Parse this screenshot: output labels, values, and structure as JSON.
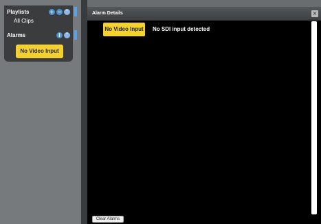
{
  "sidebar": {
    "playlists": {
      "label": "Playlists",
      "add_icon": "plus-circle-icon",
      "remove_icon": "minus-circle-icon",
      "collapse_icon": "chevron-up-circle-icon",
      "items": [
        {
          "label": "All Clips"
        }
      ]
    },
    "alarms": {
      "label": "Alarms",
      "info_icon": "info-circle-icon",
      "collapse_icon": "chevron-up-circle-icon",
      "items": [
        {
          "label": "No Video Input",
          "color": "#f4d131"
        }
      ]
    }
  },
  "dialog": {
    "title": "Alarm Details",
    "close_icon": "close-icon",
    "alarms": [
      {
        "badge": "No Video Input",
        "description": "No SDI input detected",
        "color": "#f4d131"
      }
    ],
    "clear_label": "Clear Alarms"
  },
  "colors": {
    "accent": "#4a90d8",
    "alarm_yellow": "#f4d131",
    "panel_bg": "#3a3c3e",
    "dialog_bg": "#000000"
  }
}
